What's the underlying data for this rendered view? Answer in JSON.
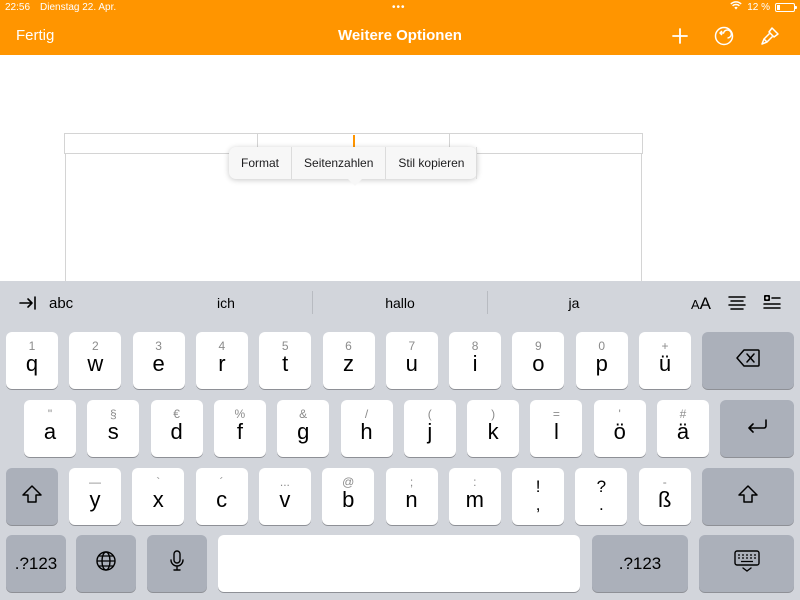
{
  "status": {
    "time": "22:56",
    "date": "Dienstag 22. Apr.",
    "dots": "•••",
    "battery": "12 %"
  },
  "nav": {
    "done_label": "Fertig",
    "title": "Weitere Optionen",
    "icons": [
      "plus-icon",
      "undo-icon",
      "paintbrush-icon"
    ]
  },
  "context_menu": {
    "items": [
      "Format",
      "Seitenzahlen",
      "Stil kopieren"
    ]
  },
  "keyboard": {
    "suggestions": {
      "left_label": "abc",
      "words": [
        "ich",
        "hallo",
        "ja"
      ],
      "format_label": "AA"
    },
    "row1": [
      {
        "main": "q",
        "alt": "1"
      },
      {
        "main": "w",
        "alt": "2"
      },
      {
        "main": "e",
        "alt": "3"
      },
      {
        "main": "r",
        "alt": "4"
      },
      {
        "main": "t",
        "alt": "5"
      },
      {
        "main": "z",
        "alt": "6"
      },
      {
        "main": "u",
        "alt": "7"
      },
      {
        "main": "i",
        "alt": "8"
      },
      {
        "main": "o",
        "alt": "9"
      },
      {
        "main": "p",
        "alt": "0"
      },
      {
        "main": "ü",
        "alt": "+"
      }
    ],
    "row2": [
      {
        "main": "a",
        "alt": "\""
      },
      {
        "main": "s",
        "alt": "§"
      },
      {
        "main": "d",
        "alt": "€"
      },
      {
        "main": "f",
        "alt": "%"
      },
      {
        "main": "g",
        "alt": "&"
      },
      {
        "main": "h",
        "alt": "/"
      },
      {
        "main": "j",
        "alt": "("
      },
      {
        "main": "k",
        "alt": ")"
      },
      {
        "main": "l",
        "alt": "="
      },
      {
        "main": "ö",
        "alt": "'"
      },
      {
        "main": "ä",
        "alt": "#"
      }
    ],
    "row3": [
      {
        "main": "y",
        "alt": "—"
      },
      {
        "main": "x",
        "alt": "`"
      },
      {
        "main": "c",
        "alt": "´"
      },
      {
        "main": "v",
        "alt": "..."
      },
      {
        "main": "b",
        "alt": "@"
      },
      {
        "main": "n",
        "alt": ";"
      },
      {
        "main": "m",
        "alt": ":"
      },
      {
        "main": "!",
        "alt": ""
      },
      {
        "main": "?",
        "alt": ""
      },
      {
        "main": "ß",
        "alt": "-"
      }
    ],
    "row3_punct_lower": [
      ",",
      "."
    ],
    "numbers_label": ".?123"
  }
}
